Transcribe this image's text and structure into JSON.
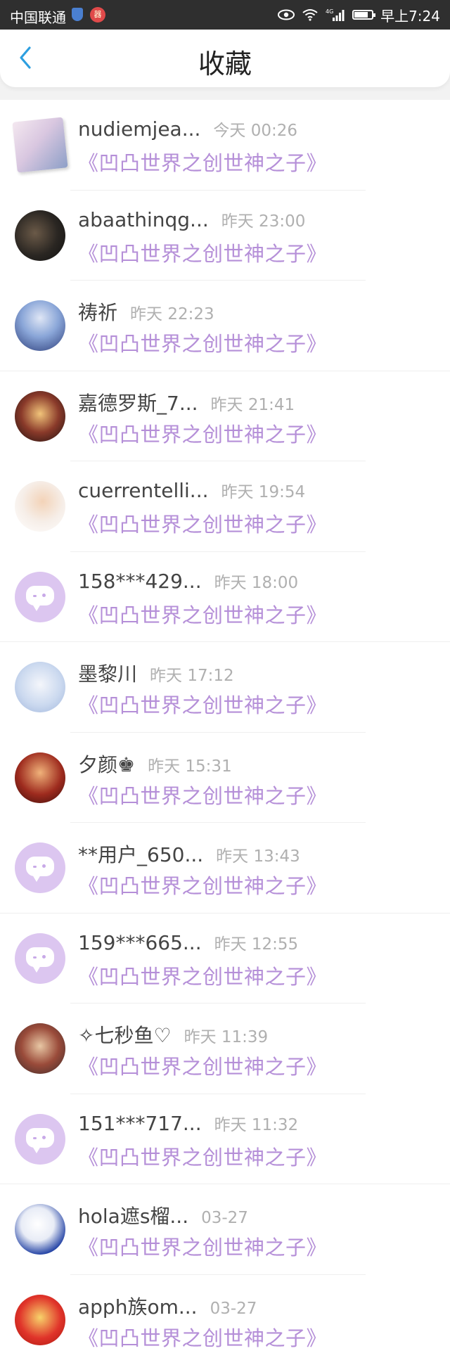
{
  "status_bar": {
    "carrier": "中国联通",
    "notif_badge": "器",
    "network": "4G",
    "time": "早上7:24",
    "battery_level": 0.75
  },
  "header": {
    "title": "收藏",
    "back_icon": "chevron-left-icon",
    "accent_color": "#2d9fe0"
  },
  "list": {
    "items": [
      {
        "name": "nudiemjea...",
        "time": "今天 00:26",
        "novel": "《凹凸世界之创世神之子》",
        "avatar": "square-photo",
        "divider": "short"
      },
      {
        "name": "abaathinqg...",
        "time": "昨天 23:00",
        "novel": "《凹凸世界之创世神之子》",
        "avatar": "photo",
        "divider": "short"
      },
      {
        "name": "祷祈",
        "time": "昨天 22:23",
        "novel": "《凹凸世界之创世神之子》",
        "avatar": "photo",
        "divider": "full"
      },
      {
        "name": "嘉德罗斯_7...",
        "time": "昨天 21:41",
        "novel": "《凹凸世界之创世神之子》",
        "avatar": "photo",
        "divider": "short"
      },
      {
        "name": "cuerrentelli...",
        "time": "昨天 19:54",
        "novel": "《凹凸世界之创世神之子》",
        "avatar": "photo",
        "divider": "short"
      },
      {
        "name": "158***429...",
        "time": "昨天 18:00",
        "novel": "《凹凸世界之创世神之子》",
        "avatar": "placeholder",
        "divider": "full"
      },
      {
        "name": "墨黎川",
        "time": "昨天 17:12",
        "novel": "《凹凸世界之创世神之子》",
        "avatar": "photo",
        "divider": "short"
      },
      {
        "name": "夕颜♚",
        "time": "昨天 15:31",
        "novel": "《凹凸世界之创世神之子》",
        "avatar": "photo",
        "divider": "short"
      },
      {
        "name": "**用户_650...",
        "time": "昨天 13:43",
        "novel": "《凹凸世界之创世神之子》",
        "avatar": "placeholder",
        "divider": "full"
      },
      {
        "name": "159***665...",
        "time": "昨天 12:55",
        "novel": "《凹凸世界之创世神之子》",
        "avatar": "placeholder",
        "divider": "short"
      },
      {
        "name": "✧七秒鱼♡",
        "time": "昨天 11:39",
        "novel": "《凹凸世界之创世神之子》",
        "avatar": "photo",
        "divider": "short"
      },
      {
        "name": "151***717...",
        "time": "昨天 11:32",
        "novel": "《凹凸世界之创世神之子》",
        "avatar": "placeholder",
        "divider": "full"
      },
      {
        "name": "hola遮s榴...",
        "time": "03-27",
        "novel": "《凹凸世界之创世神之子》",
        "avatar": "photo",
        "divider": "short"
      },
      {
        "name": "apph族om...",
        "time": "03-27",
        "novel": "《凹凸世界之创世神之子》",
        "avatar": "photo",
        "divider": "none"
      }
    ]
  },
  "colors": {
    "novel_text": "#b58fd8",
    "placeholder_avatar": "#dcc6f0",
    "status_bar_bg": "#2f2f2f"
  }
}
